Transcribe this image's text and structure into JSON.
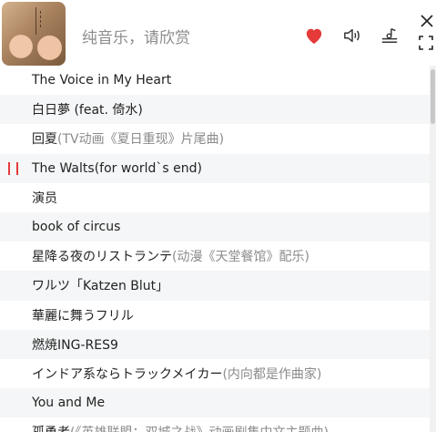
{
  "header": {
    "title": "纯音乐，请欣赏",
    "colors": {
      "heart": "#e53a3a",
      "icon": "#333333"
    },
    "icons": [
      "heart-icon",
      "volume-icon",
      "playlist-icon",
      "close-icon",
      "fullscreen-icon"
    ]
  },
  "playlist": {
    "playing_color": "#e53a3a",
    "items": [
      {
        "title": "The Voice in My Heart",
        "note": ""
      },
      {
        "title": "白日夢 (feat. 倚水)",
        "note": ""
      },
      {
        "title": "回夏",
        "note": "(TV动画《夏日重现》片尾曲)"
      },
      {
        "title": "The Walts(for world`s end)",
        "note": ""
      },
      {
        "title": "演员",
        "note": ""
      },
      {
        "title": "book of circus",
        "note": ""
      },
      {
        "title": "星降る夜のリストランテ",
        "note": "(动漫《天堂餐馆》配乐)"
      },
      {
        "title": "ワルツ「Katzen Blut」",
        "note": ""
      },
      {
        "title": "華麗に舞うフリル",
        "note": ""
      },
      {
        "title": "燃焼ING-RES9",
        "note": ""
      },
      {
        "title": "インドア系ならトラックメイカー",
        "note": "(内向都是作曲家)"
      },
      {
        "title": "You and Me",
        "note": ""
      },
      {
        "title": "孤勇者",
        "note": "(《英雄联盟：双城之战》动画剧集中文主题曲)"
      }
    ]
  }
}
